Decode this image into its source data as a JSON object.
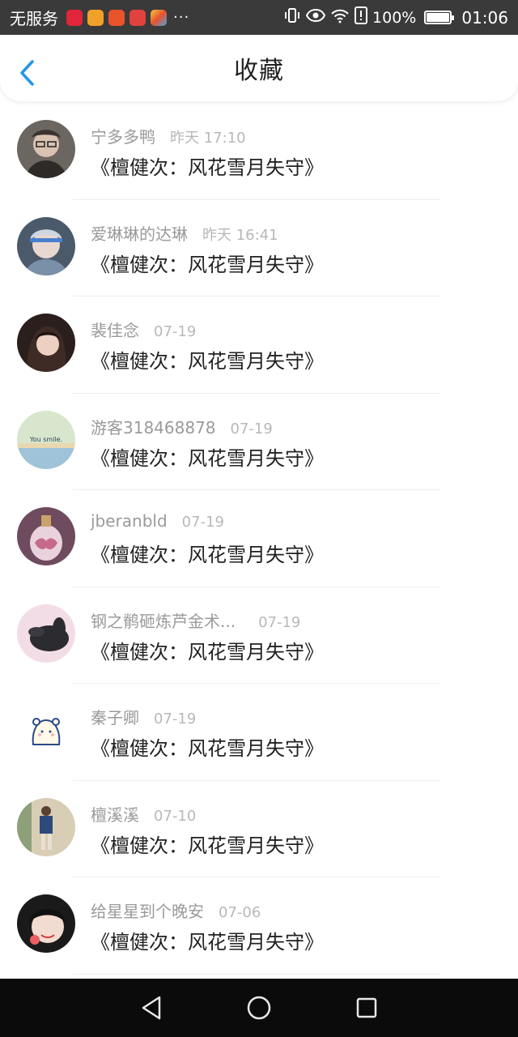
{
  "status_bar": {
    "carrier": "无服务",
    "dots": "···",
    "battery": "100%",
    "battery_level": 1.0,
    "time": "01:06",
    "app_icons": [
      "xiaohongshu-app-icon",
      "weibo-app-icon",
      "app-icon",
      "shop-app-icon",
      "colorful-app-icon"
    ],
    "app_colors": [
      "#e0263a",
      "#f0a12a",
      "#e8532b",
      "#e2423d",
      "#4aa3e8"
    ]
  },
  "header": {
    "title": "收藏",
    "back_icon": "chevron-left-icon",
    "accent_color": "#2196e8"
  },
  "items": [
    {
      "username": "宁多多鸭",
      "time": "昨天 17:10",
      "title": "《檀健次：风花雪月失守》"
    },
    {
      "username": "爱琳琳的达琳",
      "time": "昨天 16:41",
      "title": "《檀健次：风花雪月失守》"
    },
    {
      "username": "裴佳念",
      "time": "07-19",
      "title": "《檀健次：风花雪月失守》"
    },
    {
      "username": "游客318468878",
      "time": "07-19",
      "title": "《檀健次：风花雪月失守》"
    },
    {
      "username": "jberanbld",
      "time": "07-19",
      "title": "《檀健次：风花雪月失守》"
    },
    {
      "username": "钢之鹡砸炼芦金术...",
      "time": "07-19",
      "title": "《檀健次：风花雪月失守》"
    },
    {
      "username": "秦子卿",
      "time": "07-19",
      "title": "《檀健次：风花雪月失守》"
    },
    {
      "username": "檀溪溪",
      "time": "07-10",
      "title": "《檀健次：风花雪月失守》"
    },
    {
      "username": "给星星到个晚安",
      "time": "07-06",
      "title": "《檀健次：风花雪月失守》"
    }
  ],
  "avatar_text": "You smile.",
  "nav": {
    "back_icon": "nav-back-icon",
    "home_icon": "nav-home-icon",
    "recents_icon": "nav-recents-icon"
  }
}
